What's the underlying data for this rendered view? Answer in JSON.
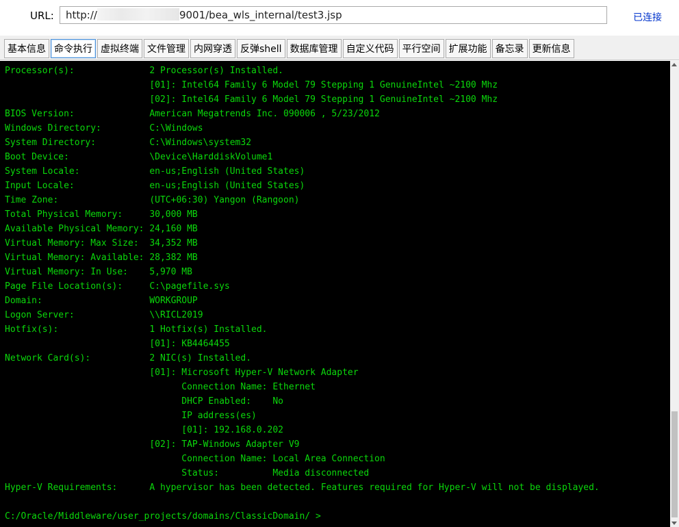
{
  "urlbar": {
    "label": "URL:",
    "url_prefix": "http://",
    "url_suffix": "9001/bea_wls_internal/test3.jsp",
    "status": "已连接"
  },
  "tabs": [
    {
      "label": "基本信息",
      "active": false
    },
    {
      "label": "命令执行",
      "active": true
    },
    {
      "label": "虚拟终端",
      "active": false
    },
    {
      "label": "文件管理",
      "active": false
    },
    {
      "label": "内网穿透",
      "active": false
    },
    {
      "label": "反弹shell",
      "active": false
    },
    {
      "label": "数据库管理",
      "active": false
    },
    {
      "label": "自定义代码",
      "active": false
    },
    {
      "label": "平行空间",
      "active": false
    },
    {
      "label": "扩展功能",
      "active": false
    },
    {
      "label": "备忘录",
      "active": false
    },
    {
      "label": "更新信息",
      "active": false
    }
  ],
  "console": {
    "text_color": "#0bd80b",
    "background": "#000000",
    "lines": [
      "Processor(s):              2 Processor(s) Installed.",
      "                           [01]: Intel64 Family 6 Model 79 Stepping 1 GenuineIntel ~2100 Mhz",
      "                           [02]: Intel64 Family 6 Model 79 Stepping 1 GenuineIntel ~2100 Mhz",
      "BIOS Version:              American Megatrends Inc. 090006 , 5/23/2012",
      "Windows Directory:         C:\\Windows",
      "System Directory:          C:\\Windows\\system32",
      "Boot Device:               \\Device\\HarddiskVolume1",
      "System Locale:             en-us;English (United States)",
      "Input Locale:              en-us;English (United States)",
      "Time Zone:                 (UTC+06:30) Yangon (Rangoon)",
      "Total Physical Memory:     30,000 MB",
      "Available Physical Memory: 24,160 MB",
      "Virtual Memory: Max Size:  34,352 MB",
      "Virtual Memory: Available: 28,382 MB",
      "Virtual Memory: In Use:    5,970 MB",
      "Page File Location(s):     C:\\pagefile.sys",
      "Domain:                    WORKGROUP",
      "Logon Server:              \\\\RICL2019",
      "Hotfix(s):                 1 Hotfix(s) Installed.",
      "                           [01]: KB4464455",
      "Network Card(s):           2 NIC(s) Installed.",
      "                           [01]: Microsoft Hyper-V Network Adapter",
      "                                 Connection Name: Ethernet",
      "                                 DHCP Enabled:    No",
      "                                 IP address(es)",
      "                                 [01]: 192.168.0.202",
      "                           [02]: TAP-Windows Adapter V9",
      "                                 Connection Name: Local Area Connection",
      "                                 Status:          Media disconnected",
      "Hyper-V Requirements:      A hypervisor has been detected. Features required for Hyper-V will not be displayed.",
      "",
      "C:/Oracle/Middleware/user_projects/domains/ClassicDomain/ >"
    ]
  }
}
